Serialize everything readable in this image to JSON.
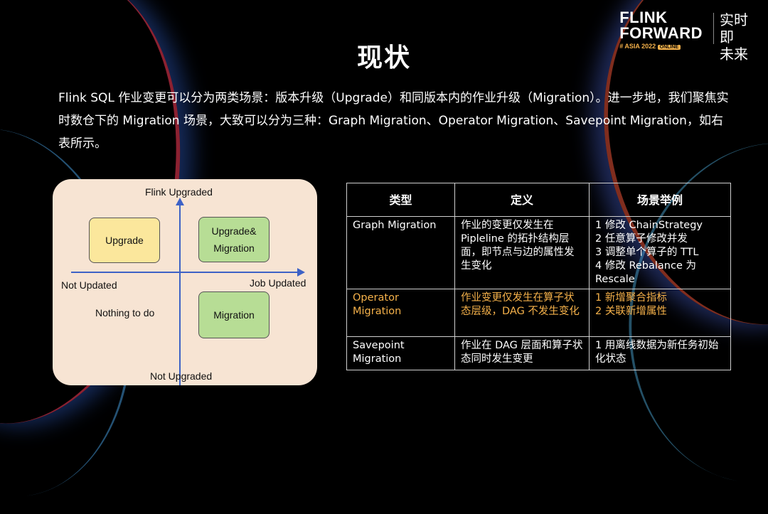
{
  "logo": {
    "line1": "FLINK",
    "line2": "FORWARD",
    "line3": "# ASIA 2022",
    "badge": "ONLINE",
    "cn_line1": "实时即",
    "cn_line2": "未来"
  },
  "title": "现状",
  "paragraph": "Flink SQL 作业变更可以分为两类场景：版本升级（Upgrade）和同版本内的作业升级（Migration）。进一步地，我们聚焦实时数仓下的 Migration 场景，大致可以分为三种：Graph Migration、Operator Migration、Savepoint Migration，如右表所示。",
  "quadrant": {
    "top_label": "Flink Upgraded",
    "bottom_label": "Not Upgraded",
    "left_label": "Not Updated",
    "right_label": "Job Updated",
    "box_upgrade": "Upgrade",
    "box_upgrade_migration_line1": "Upgrade&",
    "box_upgrade_migration_line2": "Migration",
    "box_migration": "Migration",
    "nothing_label": "Nothing to do",
    "colors": {
      "yellow": "#fbe79c",
      "green": "#b7dd95",
      "axis": "#3d62c6",
      "background": "#f7e4d3"
    }
  },
  "table": {
    "headers": [
      "类型",
      "定义",
      "场景举例"
    ],
    "rows": [
      {
        "type": "Graph Migration",
        "definition": "作业的变更仅发生在 Pipleline 的拓扑结构层面，即节点与边的属性发生变化",
        "examples": [
          "1 修改 ChainStrategy",
          "2 任意算子修改并发",
          "3 调整单个算子的 TTL",
          "4 修改 Rebalance 为 Rescale"
        ]
      },
      {
        "type": "Operator Migration",
        "definition": "作业变更仅发生在算子状态层级，DAG 不发生变化",
        "examples": [
          "1 新增聚合指标",
          "2 关联新增属性"
        ]
      },
      {
        "type": "Savepoint Migration",
        "definition": "作业在 DAG 层面和算子状态同时发生变更",
        "examples": [
          "1 用离线数据为新任务初始化状态"
        ]
      }
    ],
    "highlight_color": "#f5b14a"
  }
}
